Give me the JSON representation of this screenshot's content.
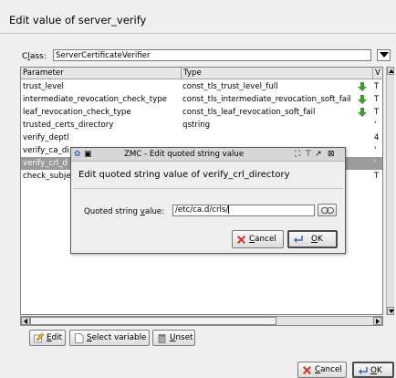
{
  "window": {
    "title": "Edit value of server_verify"
  },
  "class_field": {
    "label_pre": "C",
    "label_acc": "l",
    "label_post": "ass:",
    "value": "ServerCertificateVerifier"
  },
  "table": {
    "headers": [
      "Parameter",
      "Type",
      "V"
    ],
    "rows": [
      {
        "param": "trust_level",
        "type": "const_tls_trust_level_full",
        "icon": "download-arrow-icon",
        "v": "T"
      },
      {
        "param": "intermediate_revocation_check_type",
        "type": "const_tls_intermediate_revocation_soft_fail",
        "icon": "download-arrow-icon",
        "v": "T"
      },
      {
        "param": "leaf_revocation_check_type",
        "type": "const_tls_leaf_revocation_soft_fail",
        "icon": "download-arrow-icon",
        "v": "T"
      },
      {
        "param": "trusted_certs_directory",
        "type": "qstring",
        "icon": "",
        "v": "'"
      },
      {
        "param": "verify_deptl",
        "type": "",
        "icon": "",
        "v": "4"
      },
      {
        "param": "verify_ca_di",
        "type": "",
        "icon": "",
        "v": "'"
      },
      {
        "param": "verify_crl_d",
        "type": "",
        "icon": "",
        "v": "'"
      },
      {
        "param": "check_subje",
        "type": "",
        "icon": "",
        "v": "T"
      }
    ],
    "selected_index": 6
  },
  "buttons": {
    "edit_acc": "E",
    "edit_rest": "dit",
    "select_acc": "S",
    "select_rest": "elect variable",
    "unset_acc": "U",
    "unset_rest": "nset",
    "cancel_acc": "C",
    "cancel_rest": "ancel",
    "ok_acc": "O",
    "ok_rest": "K"
  },
  "modal": {
    "title": "ZMC - Edit quoted string value",
    "heading": "Edit quoted string value of verify_crl_directory",
    "field_label_pre": "Quoted string ",
    "field_label_acc": "v",
    "field_label_post": "alue:",
    "field_value": "/etc/ca.d/crls/",
    "cancel_acc": "C",
    "cancel_rest": "ancel",
    "ok_acc": "O",
    "ok_rest": "K"
  },
  "colors": {
    "selection": "#9b9b9b",
    "download_icon": "#3a9a2a",
    "cancel_icon": "#d03a2a"
  }
}
